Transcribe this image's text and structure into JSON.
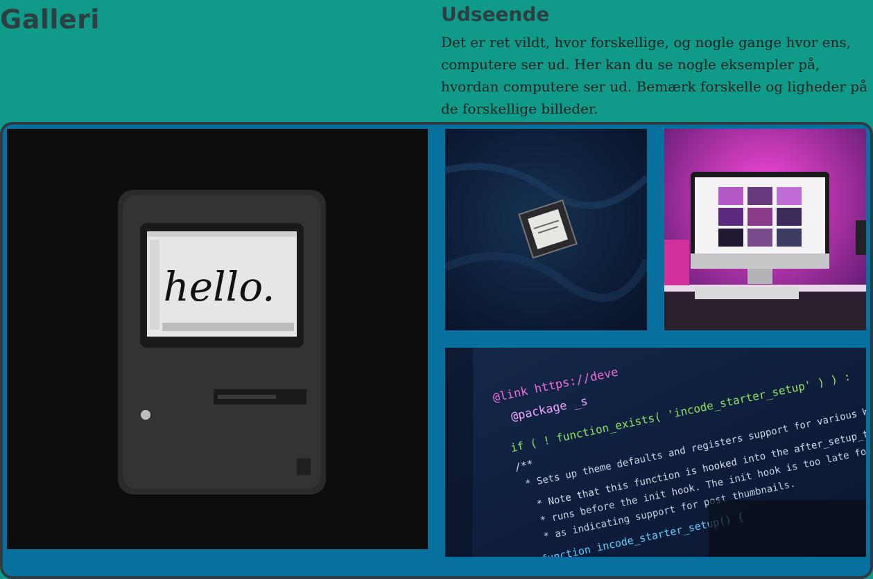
{
  "header": {
    "title": "Galleri"
  },
  "section": {
    "heading": "Udseende",
    "text": "Det er ret vildt, hvor forskellige, og nogle gange hvor ens, computere ser ud. Her kan du se nogle eksempler på, hvordan computere ser ud. Bemærk forskelle og ligheder på de forskellige billeder."
  },
  "gallery": {
    "images": [
      {
        "name": "retro-mac-hello-photo",
        "screen_text": "hello."
      },
      {
        "name": "cpu-chip-photo"
      },
      {
        "name": "imac-pink-light-photo"
      },
      {
        "name": "code-screen-photo",
        "code_lines": [
          "@link https://deve",
          "@package _s",
          "if ( ! function_exists( 'incode_starter_setup' ) ) :",
          "/**",
          " * Sets up theme defaults and registers support for various WordPress fea",
          " * Note that this function is hooked into the after_setup_theme hook, which",
          " * runs before the init hook. The init hook is too late for some features",
          " * as indicating support for post thumbnails.",
          "function incode_starter_setup() {"
        ]
      }
    ]
  },
  "colors": {
    "background": "#0f9a8a",
    "gallery_bg": "#07709e",
    "heading": "#2d3f40",
    "text": "#10221f"
  }
}
